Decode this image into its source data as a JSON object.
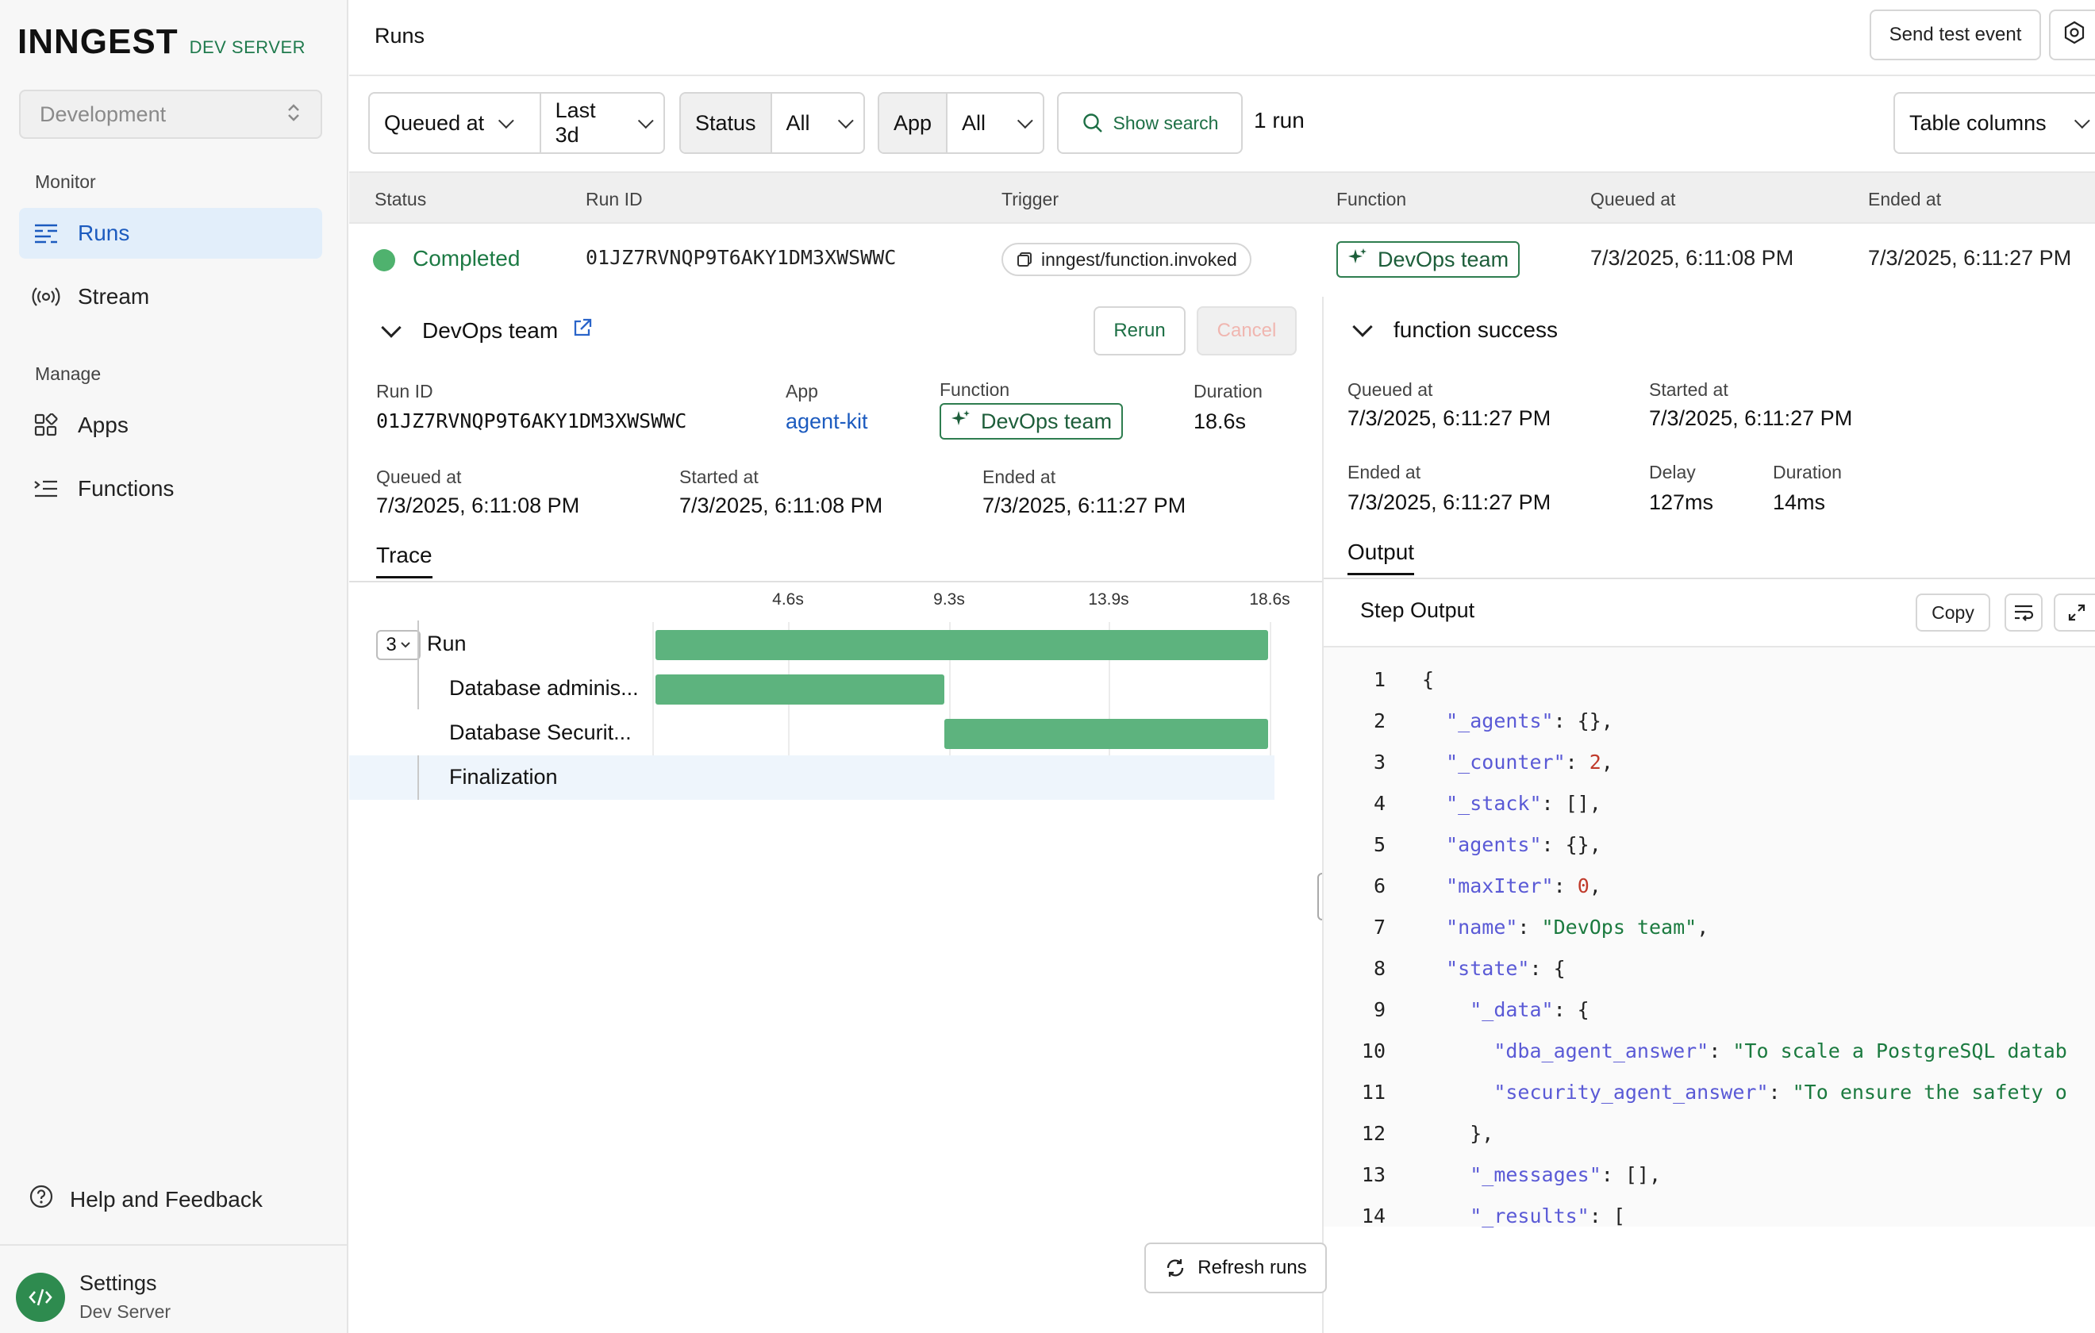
{
  "sidebar": {
    "logo": "INNGEST",
    "logo_sub": "DEV SERVER",
    "environment": "Development",
    "monitor_label": "Monitor",
    "manage_label": "Manage",
    "items": [
      {
        "label": "Runs",
        "icon": "runs-icon",
        "active": true
      },
      {
        "label": "Stream",
        "icon": "stream-icon"
      },
      {
        "label": "Apps",
        "icon": "apps-icon"
      },
      {
        "label": "Functions",
        "icon": "functions-icon"
      }
    ],
    "help": "Help and Feedback",
    "settings": {
      "title": "Settings",
      "subtitle": "Dev Server"
    }
  },
  "header": {
    "title": "Runs",
    "send_test_event": "Send test event"
  },
  "filters": {
    "queued_at": "Queued at",
    "range": "Last 3d",
    "status_label": "Status",
    "status_value": "All",
    "app_label": "App",
    "app_value": "All",
    "show_search": "Show search",
    "run_count": "1 run",
    "table_columns": "Table columns"
  },
  "table": {
    "columns": [
      "Status",
      "Run ID",
      "Trigger",
      "Function",
      "Queued at",
      "Ended at"
    ],
    "row": {
      "status": "Completed",
      "run_id": "01JZ7RVNQP9T6AKY1DM3XWSWWC",
      "trigger": "inngest/function.invoked",
      "function": "DevOps team",
      "queued_at": "7/3/2025, 6:11:08 PM",
      "ended_at": "7/3/2025, 6:11:27 PM"
    }
  },
  "detail": {
    "title": "DevOps team",
    "rerun": "Rerun",
    "cancel": "Cancel",
    "run_id_label": "Run ID",
    "run_id": "01JZ7RVNQP9T6AKY1DM3XWSWWC",
    "app_label": "App",
    "app": "agent-kit",
    "function_label": "Function",
    "function": "DevOps team",
    "duration_label": "Duration",
    "duration": "18.6s",
    "queued_label": "Queued at",
    "queued": "7/3/2025, 6:11:08 PM",
    "started_label": "Started at",
    "started": "7/3/2025, 6:11:08 PM",
    "ended_label": "Ended at",
    "ended": "7/3/2025, 6:11:27 PM",
    "trace_tab": "Trace"
  },
  "trace": {
    "ticks": [
      "4.6s",
      "9.3s",
      "13.9s",
      "18.6s"
    ],
    "total_seconds": 18.6,
    "count": "3",
    "rows": [
      {
        "label": "Run",
        "start": 0,
        "end": 18.6
      },
      {
        "label": "Database adminis...",
        "start": 0,
        "end": 8.7
      },
      {
        "label": "Database Securit...",
        "start": 8.7,
        "end": 18.5
      },
      {
        "label": "Finalization",
        "start": 18.5,
        "end": 18.6
      }
    ]
  },
  "step": {
    "title": "function success",
    "queued_label": "Queued at",
    "queued": "7/3/2025, 6:11:27 PM",
    "started_label": "Started at",
    "started": "7/3/2025, 6:11:27 PM",
    "ended_label": "Ended at",
    "ended": "7/3/2025, 6:11:27 PM",
    "delay_label": "Delay",
    "delay": "127ms",
    "duration_label": "Duration",
    "duration": "14ms",
    "output_tab": "Output",
    "output_header": "Step Output",
    "copy": "Copy"
  },
  "code_lines": [
    {
      "n": "1",
      "indent": 0,
      "parts": [
        {
          "t": "p",
          "v": "{"
        }
      ]
    },
    {
      "n": "2",
      "indent": 1,
      "parts": [
        {
          "t": "k",
          "v": "\"_agents\""
        },
        {
          "t": "p",
          "v": ": {},"
        }
      ]
    },
    {
      "n": "3",
      "indent": 1,
      "parts": [
        {
          "t": "k",
          "v": "\"_counter\""
        },
        {
          "t": "p",
          "v": ": "
        },
        {
          "t": "n",
          "v": "2"
        },
        {
          "t": "p",
          "v": ","
        }
      ]
    },
    {
      "n": "4",
      "indent": 1,
      "parts": [
        {
          "t": "k",
          "v": "\"_stack\""
        },
        {
          "t": "p",
          "v": ": [],"
        }
      ]
    },
    {
      "n": "5",
      "indent": 1,
      "parts": [
        {
          "t": "k",
          "v": "\"agents\""
        },
        {
          "t": "p",
          "v": ": {},"
        }
      ]
    },
    {
      "n": "6",
      "indent": 1,
      "parts": [
        {
          "t": "k",
          "v": "\"maxIter\""
        },
        {
          "t": "p",
          "v": ": "
        },
        {
          "t": "n",
          "v": "0"
        },
        {
          "t": "p",
          "v": ","
        }
      ]
    },
    {
      "n": "7",
      "indent": 1,
      "parts": [
        {
          "t": "k",
          "v": "\"name\""
        },
        {
          "t": "p",
          "v": ": "
        },
        {
          "t": "s",
          "v": "\"DevOps team\""
        },
        {
          "t": "p",
          "v": ","
        }
      ]
    },
    {
      "n": "8",
      "indent": 1,
      "parts": [
        {
          "t": "k",
          "v": "\"state\""
        },
        {
          "t": "p",
          "v": ": {"
        }
      ]
    },
    {
      "n": "9",
      "indent": 2,
      "parts": [
        {
          "t": "k",
          "v": "\"_data\""
        },
        {
          "t": "p",
          "v": ": {"
        }
      ]
    },
    {
      "n": "10",
      "indent": 3,
      "parts": [
        {
          "t": "k",
          "v": "\"dba_agent_answer\""
        },
        {
          "t": "p",
          "v": ": "
        },
        {
          "t": "s",
          "v": "\"To scale a PostgreSQL datab"
        }
      ]
    },
    {
      "n": "11",
      "indent": 3,
      "parts": [
        {
          "t": "k",
          "v": "\"security_agent_answer\""
        },
        {
          "t": "p",
          "v": ": "
        },
        {
          "t": "s",
          "v": "\"To ensure the safety o"
        }
      ]
    },
    {
      "n": "12",
      "indent": 2,
      "parts": [
        {
          "t": "p",
          "v": "},"
        }
      ]
    },
    {
      "n": "13",
      "indent": 2,
      "parts": [
        {
          "t": "k",
          "v": "\"_messages\""
        },
        {
          "t": "p",
          "v": ": [],"
        }
      ]
    },
    {
      "n": "14",
      "indent": 2,
      "parts": [
        {
          "t": "k",
          "v": "\"_results\""
        },
        {
          "t": "p",
          "v": ": ["
        }
      ]
    }
  ],
  "refresh": "Refresh runs",
  "colors": {
    "accent_blue": "#1c5bbf",
    "success_green": "#4fb26e",
    "bar_green": "#5db37e",
    "json_key": "#5a5ad6",
    "json_string": "#1b7a3f",
    "json_number": "#c03a2b"
  }
}
